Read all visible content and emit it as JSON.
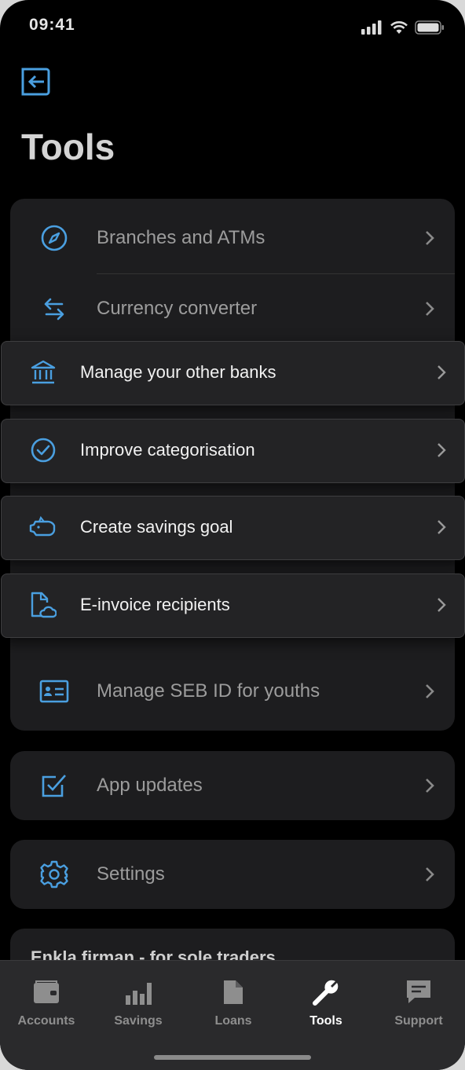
{
  "status": {
    "time": "09:41"
  },
  "page": {
    "title": "Tools"
  },
  "card1": {
    "items": [
      {
        "label": "Branches and ATMs",
        "icon": "compass-icon"
      },
      {
        "label": "Currency converter",
        "icon": "swap-arrows-icon"
      }
    ]
  },
  "popups": [
    {
      "label": "Manage your other banks",
      "icon": "bank-icon"
    },
    {
      "label": "Improve categorisation",
      "icon": "check-circle-icon"
    },
    {
      "label": "Create savings goal",
      "icon": "piggy-bank-icon"
    },
    {
      "label": "E-invoice recipients",
      "icon": "document-cloud-icon"
    }
  ],
  "card1_bottom": {
    "label": "Manage SEB ID for youths",
    "icon": "id-card-icon"
  },
  "card2": {
    "label": "App updates",
    "icon": "checkbox-icon"
  },
  "card3": {
    "label": "Settings",
    "icon": "gear-icon"
  },
  "peek": {
    "text": "Enkla firman - for sole traders"
  },
  "tabs": [
    {
      "label": "Accounts",
      "icon": "wallet-icon"
    },
    {
      "label": "Savings",
      "icon": "bar-chart-icon"
    },
    {
      "label": "Loans",
      "icon": "document-icon"
    },
    {
      "label": "Tools",
      "icon": "wrench-icon"
    },
    {
      "label": "Support",
      "icon": "chat-icon"
    }
  ],
  "colors": {
    "accent": "#4a9fe0",
    "background": "#000000",
    "card": "#1d1d1f"
  }
}
